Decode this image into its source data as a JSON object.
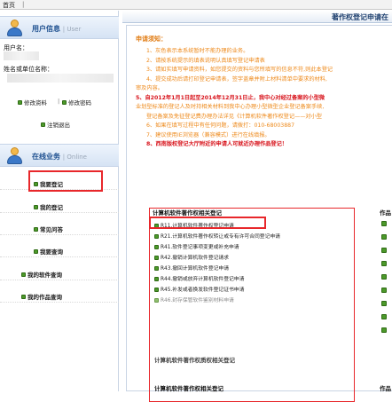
{
  "topbar": {
    "home": "首页",
    "separator": "|"
  },
  "user_panel": {
    "title": "用户信息",
    "subtitle": "User",
    "username_label": "用户名：",
    "org_label": "姓名或单位名称：",
    "edit_profile": "修改资料",
    "divider": "|",
    "change_password": "修改密码",
    "logout": "注销退出"
  },
  "business_panel": {
    "title": "在线业务",
    "subtitle": "Online",
    "items": [
      {
        "label": "我要登记"
      },
      {
        "label": "我的登记"
      },
      {
        "label": "常见问答"
      },
      {
        "label": "我要查询"
      },
      {
        "label": "我的软件查询"
      },
      {
        "label": "我的作品查询"
      }
    ]
  },
  "main": {
    "header_title": "著作权登记申请在",
    "notice_title": "申请须知：",
    "notice_lines": [
      "1、灰色表示本系统暂时不能办理的业务。",
      "2、请按系统提示的填表说明认真填写登记申请表",
      "3、请如实填写申请资料，如您提交的资料与您所填写的信息不符,则此本登记",
      "4、提交成功后请打印登记申请表，签字盖章并附上材料清单中要求的材料,",
      "审及内容。",
      "5、自2012年1月1日起至2014年12月31日止，我中心对经过备案的小型微",
      "业划型标准的登记人及时持相关材料到我中心办理小型微型企业登记备案手续,",
      "登记备案及免征登记费办理办法详见《计算机软件著作权登记——对小型",
      "6、如果在填写过程中有任何问题，请拨打：010-68003887",
      "7、建议使用IE浏览器（兼容模式）进行在线填报。",
      "8、西南版权登记大厅附近的申请人可就近办理作品登记！"
    ],
    "section1_title": "计算机软件著作权相关登记",
    "col_head": "作品",
    "section1_items": [
      {
        "label": "R11.计算机软件著作权登记申请"
      },
      {
        "label": "R21.计算机软件著作权转让或专有许可合同登记申请"
      },
      {
        "label": "R41.软件登记事项变更或补充申请"
      },
      {
        "label": "R42.撤销计算机软件登记请求"
      },
      {
        "label": "R43.撤回计算机软件登记申请"
      },
      {
        "label": "R44.撤销或放弃计算机软件登记申请"
      },
      {
        "label": "R45.补发或者换发软件登记证书申请"
      },
      {
        "label": "R46.封存保管软件鉴别材料申请"
      }
    ],
    "section2_title": "计算机软件著作权质权相关登记",
    "section3_title": "计算机软件著作权相关登记"
  }
}
